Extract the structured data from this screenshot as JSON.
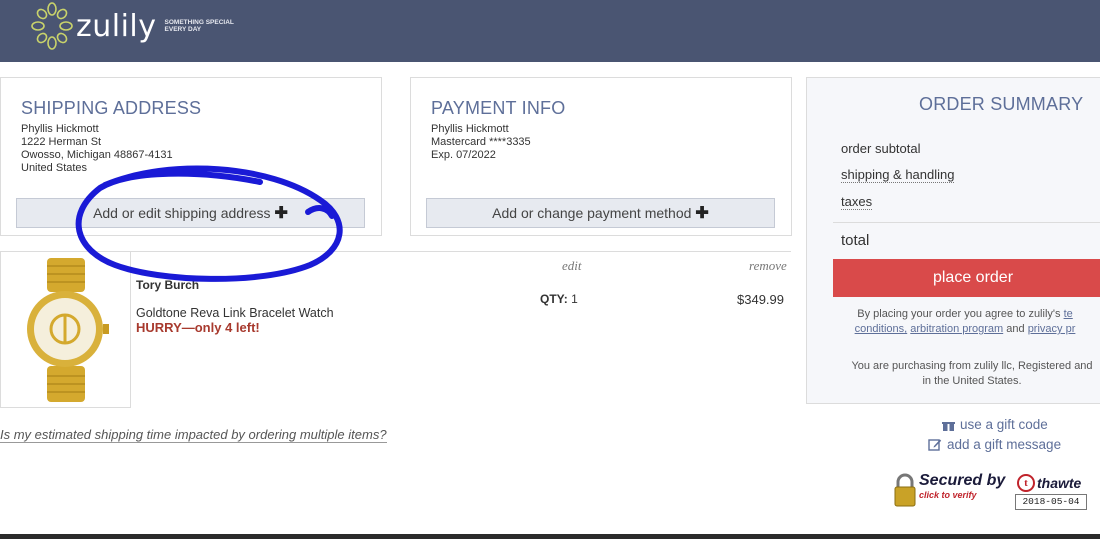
{
  "header": {
    "logo_text": "zulily",
    "tagline_1": "SOMETHING SPECIAL",
    "tagline_2": "EVERY DAY",
    "bg_color": "#4a5572"
  },
  "shipping": {
    "title": "SHIPPING ADDRESS",
    "name": "Phyllis Hickmott",
    "street": "1222 Herman St",
    "city": "Owosso, Michigan 48867-4131",
    "country": "United States",
    "button_label": "Add or edit shipping address",
    "button_icon": "plus-icon"
  },
  "payment": {
    "title": "PAYMENT INFO",
    "name": "Phyllis Hickmott",
    "card": "Mastercard ****3335",
    "exp": "Exp. 07/2022",
    "button_label": "Add or change payment method",
    "button_icon": "plus-icon"
  },
  "cart": {
    "edit_label": "edit",
    "remove_label": "remove",
    "item": {
      "brand": "Tory Burch",
      "name": "Goldtone Reva Link Bracelet Watch",
      "urgency": "HURRY—only 4 left!",
      "qty_label": "QTY:",
      "qty": "1",
      "price": "$349.99"
    },
    "shipping_question": "Is my estimated shipping time impacted by ordering multiple items?"
  },
  "summary": {
    "title": "ORDER SUMMARY",
    "subtotal_label": "order subtotal",
    "shipping_label": "shipping & handling",
    "taxes_label": "taxes",
    "total_label": "total",
    "place_order_label": "place order",
    "agree_prefix": "By placing your order you agree to zulily's",
    "agree_terms": "te",
    "agree_conditions": "conditions,",
    "agree_arbitration": "arbitration program",
    "agree_and": "and",
    "agree_privacy": "privacy pr",
    "purchasing_line1": "You are purchasing from zulily llc, Registered and",
    "purchasing_line2": "in the United States.",
    "place_order_color": "#d94a4a"
  },
  "gift": {
    "code_label": "use a gift code",
    "message_label": "add a gift message"
  },
  "seal": {
    "secured_label": "Secured by",
    "brand": "thawte",
    "click_label": "click to verify",
    "date": "2018-05-04"
  },
  "accent_color": "#5e6f99"
}
